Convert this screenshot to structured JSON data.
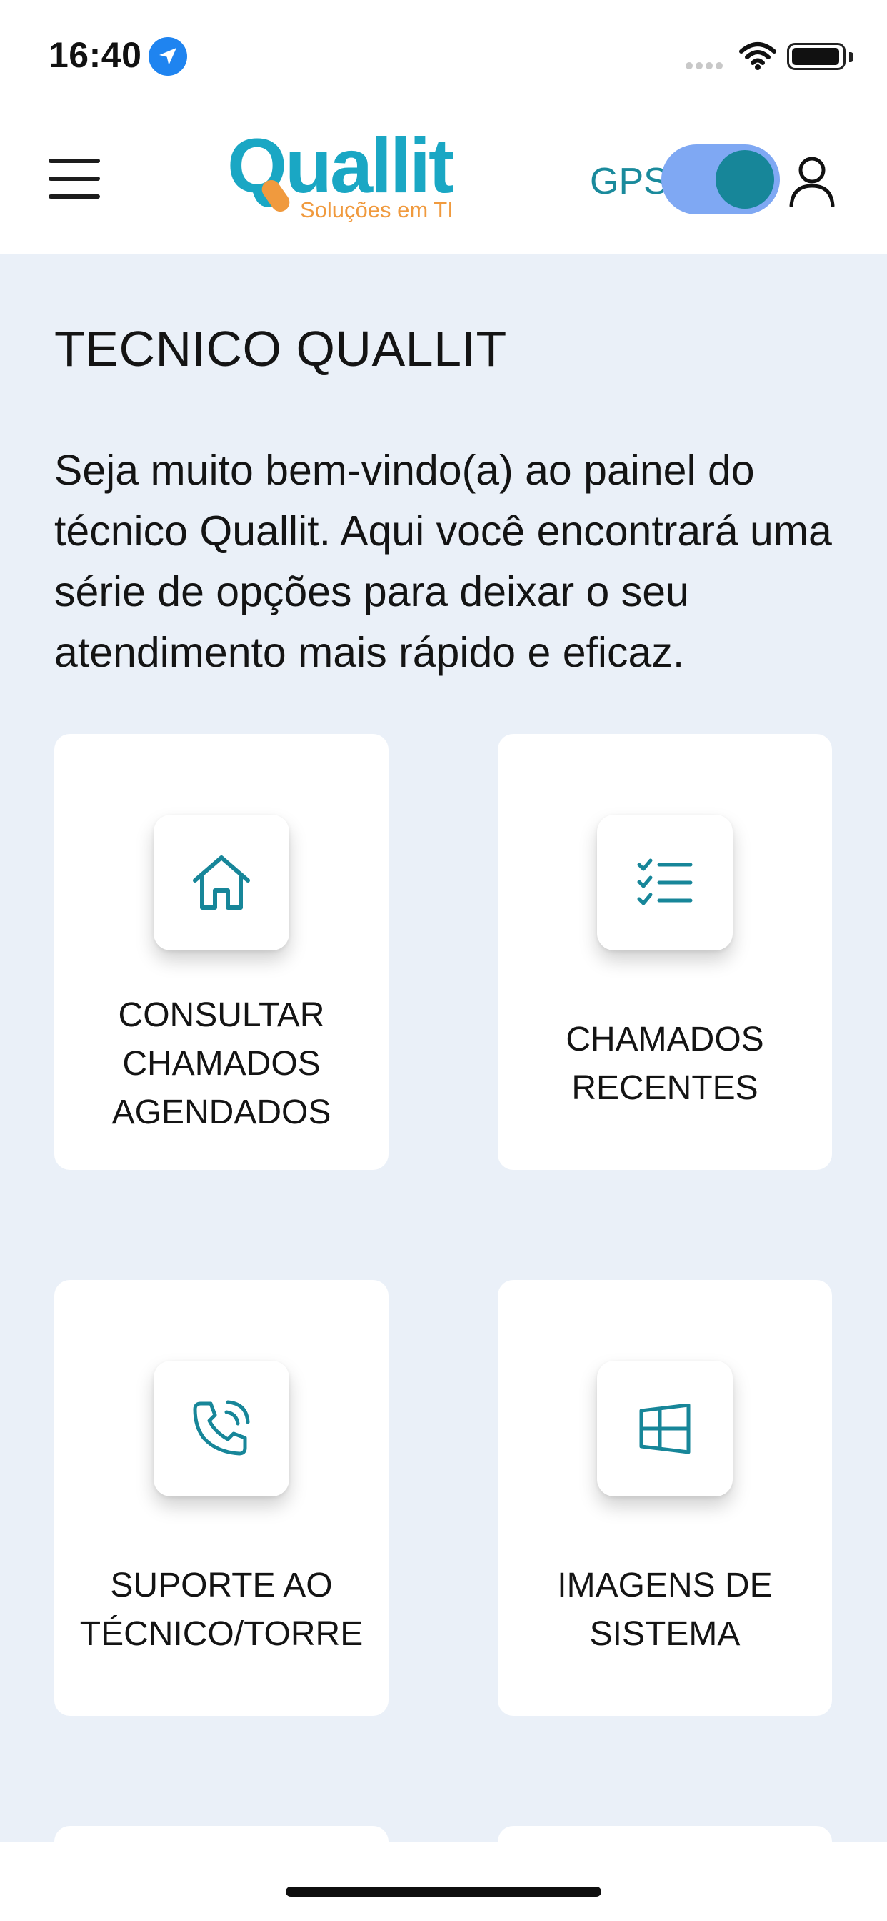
{
  "status_bar": {
    "time": "16:40",
    "icons": [
      "location-arrow-icon",
      "cellular-signal-icon",
      "wifi-icon",
      "battery-icon"
    ]
  },
  "header": {
    "menu_icon": "hamburger-menu-icon",
    "logo": {
      "word": "Quallit",
      "tagline": "Soluções em TI"
    },
    "gps_label": "GPS",
    "gps_enabled": true,
    "profile_icon": "user-profile-icon"
  },
  "page": {
    "title": "TECNICO QUALLIT",
    "intro": "Seja muito bem-vindo(a) ao painel do técnico Quallit. Aqui você encontrará uma série de opções para deixar o seu atendimento mais rápido e eficaz."
  },
  "cards": [
    {
      "icon": "home-icon",
      "label": "CONSULTAR CHAMADOS AGENDADOS"
    },
    {
      "icon": "checklist-icon",
      "label": "CHAMADOS RECENTES"
    },
    {
      "icon": "phone-calling-icon",
      "label": "SUPORTE AO TÉCNICO/TORRE"
    },
    {
      "icon": "windows-icon",
      "label": "IMAGENS DE SISTEMA"
    }
  ],
  "colors": {
    "brand": "#1aa7c4",
    "accent": "#f09a3e",
    "icon_teal": "#178699",
    "toggle_track": "#7fa8f3",
    "background": "#eaf0f8"
  }
}
